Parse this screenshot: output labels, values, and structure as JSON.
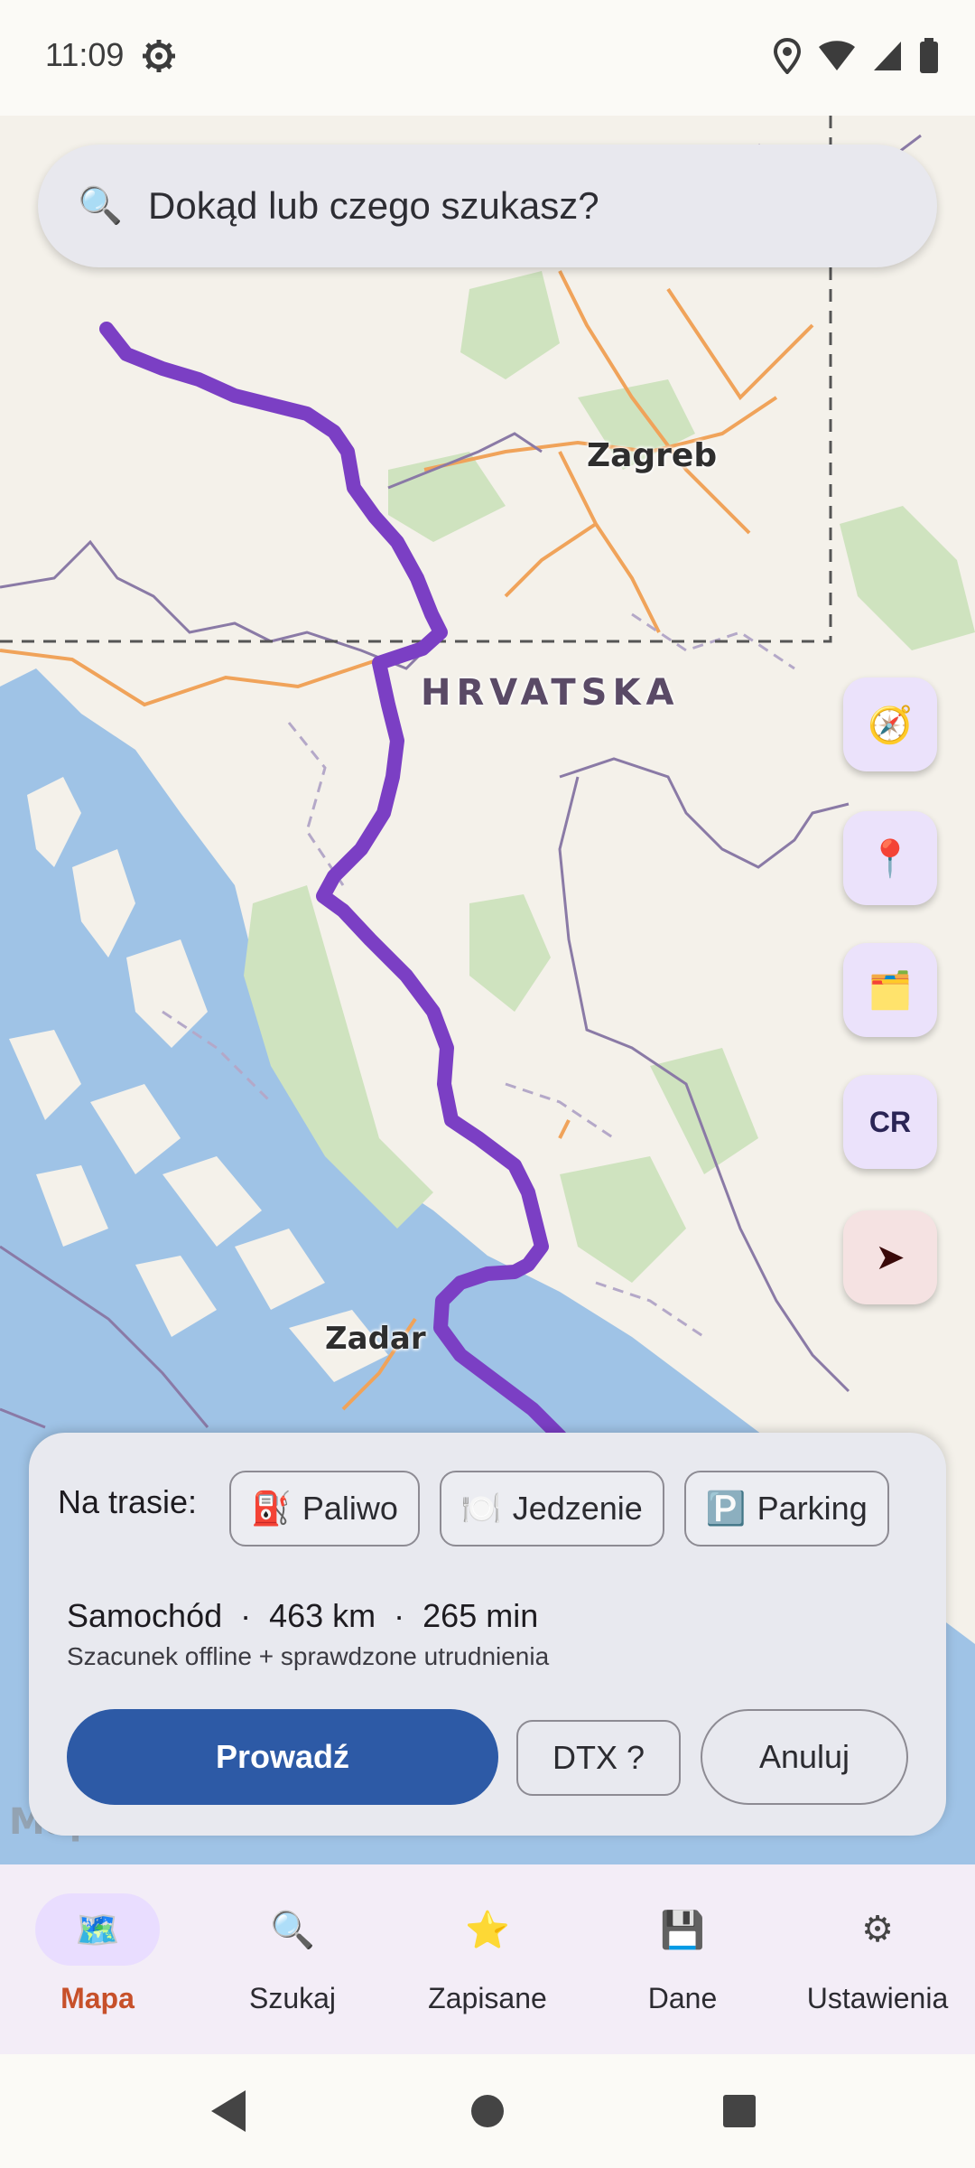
{
  "status_bar": {
    "time": "11:09"
  },
  "search": {
    "placeholder": "Dokąd lub czego szukasz?"
  },
  "map": {
    "labels": {
      "zagreb": "Zagreb",
      "country": "HRVATSKA",
      "zadar": "Zadar"
    },
    "attribution": "MapLibre",
    "route_color": "#7b3fc4"
  },
  "fabs": [
    {
      "name": "compass",
      "icon": "🧭"
    },
    {
      "name": "pin",
      "icon": "📍"
    },
    {
      "name": "folder",
      "icon": "🗂️"
    },
    {
      "name": "cr",
      "label": "CR"
    },
    {
      "name": "navigate",
      "icon": "➤"
    }
  ],
  "route_sheet": {
    "on_route_label": "Na trasie:",
    "chips": [
      {
        "icon": "⛽",
        "label": "Paliwo"
      },
      {
        "icon": "🍽️",
        "label": "Jedzenie"
      },
      {
        "icon": "🅿️",
        "label": "Parking"
      }
    ],
    "summary": "Samochód  ·  463 km  ·  265 min",
    "note": "Szacunek offline + sprawdzone utrudnienia",
    "drive_label": "Prowadź",
    "dtx_label": "DTX ?",
    "cancel_label": "Anuluj"
  },
  "bottom_nav": [
    {
      "icon": "🗺️",
      "label": "Mapa",
      "active": true
    },
    {
      "icon": "🔍",
      "label": "Szukaj",
      "active": false
    },
    {
      "icon": "⭐",
      "label": "Zapisane",
      "active": false
    },
    {
      "icon": "💾",
      "label": "Dane",
      "active": false
    },
    {
      "icon": "⚙",
      "label": "Ustawienia",
      "active": false
    }
  ],
  "colors": {
    "primary": "#2d5aa6",
    "active_nav": "#c7502a",
    "route": "#7b3fc4"
  }
}
